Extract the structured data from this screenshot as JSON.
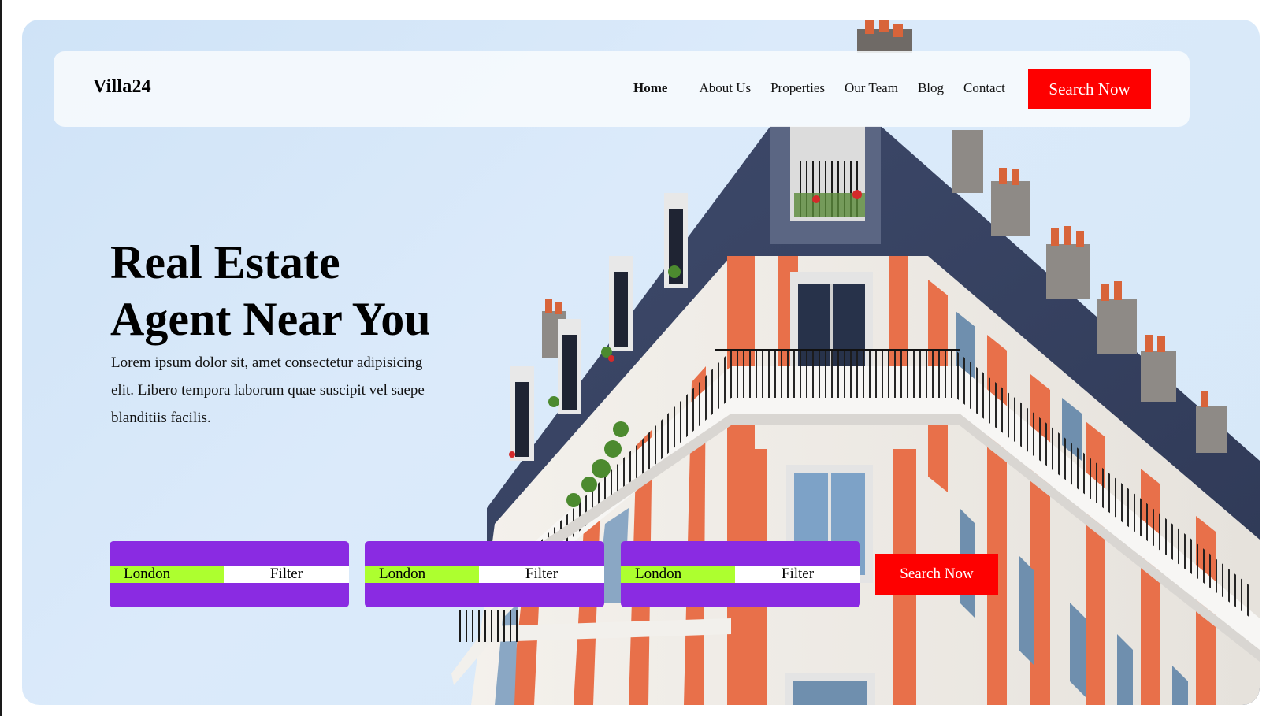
{
  "brand": {
    "logo_text": "Villa24"
  },
  "nav": {
    "links": [
      "Home",
      "About Us",
      "Properties",
      "Our Team",
      "Blog",
      "Contact"
    ],
    "active": "Home",
    "cta_label": "Search Now"
  },
  "hero": {
    "title_line1": "Real Estate",
    "title_line2": "Agent Near You",
    "description": "Lorem ipsum dolor sit, amet consectetur adipisicing elit. Libero tempora laborum quae suscipit vel saepe blanditiis facilis.",
    "image_name": "parisian-apartment-building"
  },
  "search": {
    "filters": [
      {
        "location": "London",
        "button": "Filter"
      },
      {
        "location": "London",
        "button": "Filter"
      },
      {
        "location": "London",
        "button": "Filter"
      }
    ],
    "cta_label": "Search Now"
  },
  "colors": {
    "cta": "#fe0000",
    "filter_card": "#8a2be2",
    "location_chip": "#adff2f"
  }
}
